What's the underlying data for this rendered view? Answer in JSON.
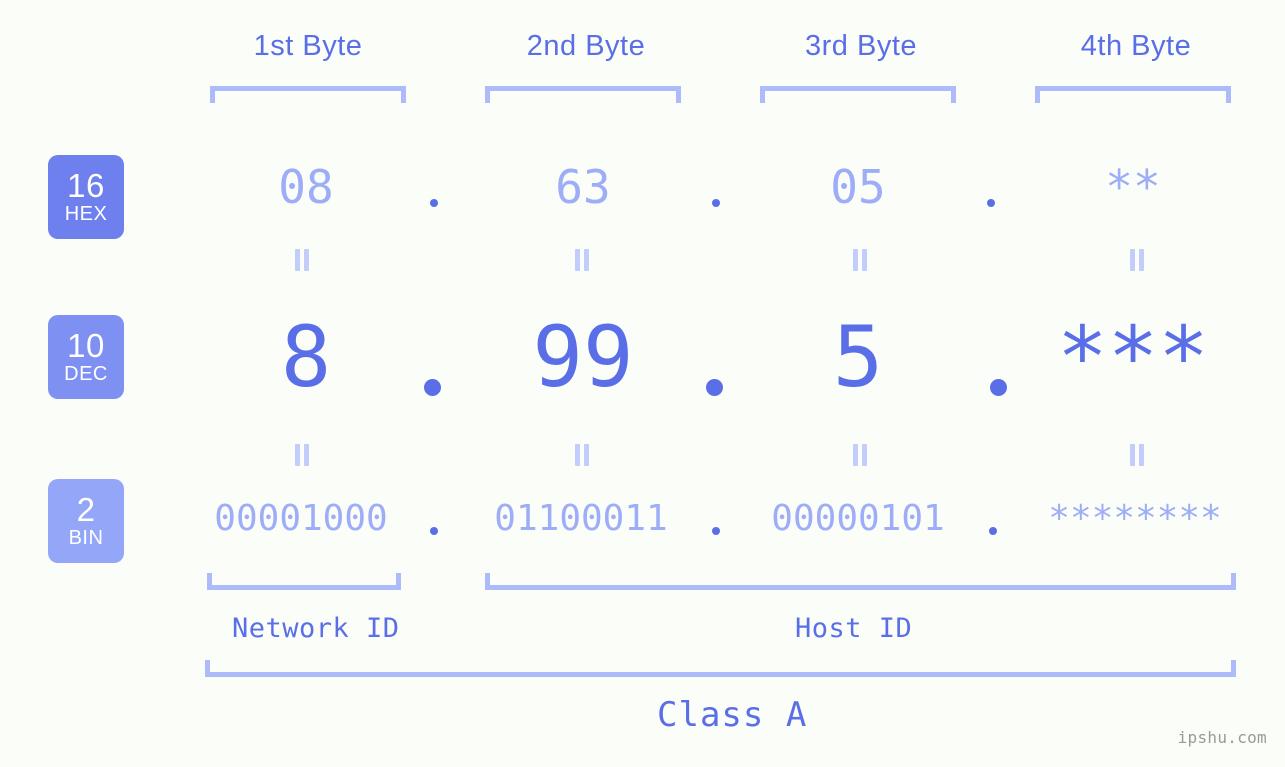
{
  "meta": {
    "background": "#fbfdf8",
    "accent": "#5a6ee8",
    "accent_light": "#9dadf7",
    "bracket": "#aebbfb",
    "badge_strong": "#6d80ee",
    "badge_light": "#93a6f8"
  },
  "headers": {
    "bytes": [
      {
        "label": "1st Byte"
      },
      {
        "label": "2nd Byte"
      },
      {
        "label": "3rd Byte"
      },
      {
        "label": "4th Byte"
      }
    ]
  },
  "rows": [
    {
      "id": "hex",
      "badge_number": "16",
      "badge_name": "HEX",
      "values": [
        "08",
        "63",
        "05",
        "**"
      ]
    },
    {
      "id": "dec",
      "badge_number": "10",
      "badge_name": "DEC",
      "values": [
        "8",
        "99",
        "5",
        "***"
      ]
    },
    {
      "id": "bin",
      "badge_number": "2",
      "badge_name": "BIN",
      "values": [
        "00001000",
        "01100011",
        "00000101",
        "********"
      ]
    }
  ],
  "separators": {
    "hex": ".",
    "dec": ".",
    "bin": "."
  },
  "equality": {
    "symbol": "="
  },
  "footer": {
    "network_id_label": "Network ID",
    "host_id_label": "Host ID",
    "class_label": "Class A",
    "watermark": "ipshu.com"
  }
}
